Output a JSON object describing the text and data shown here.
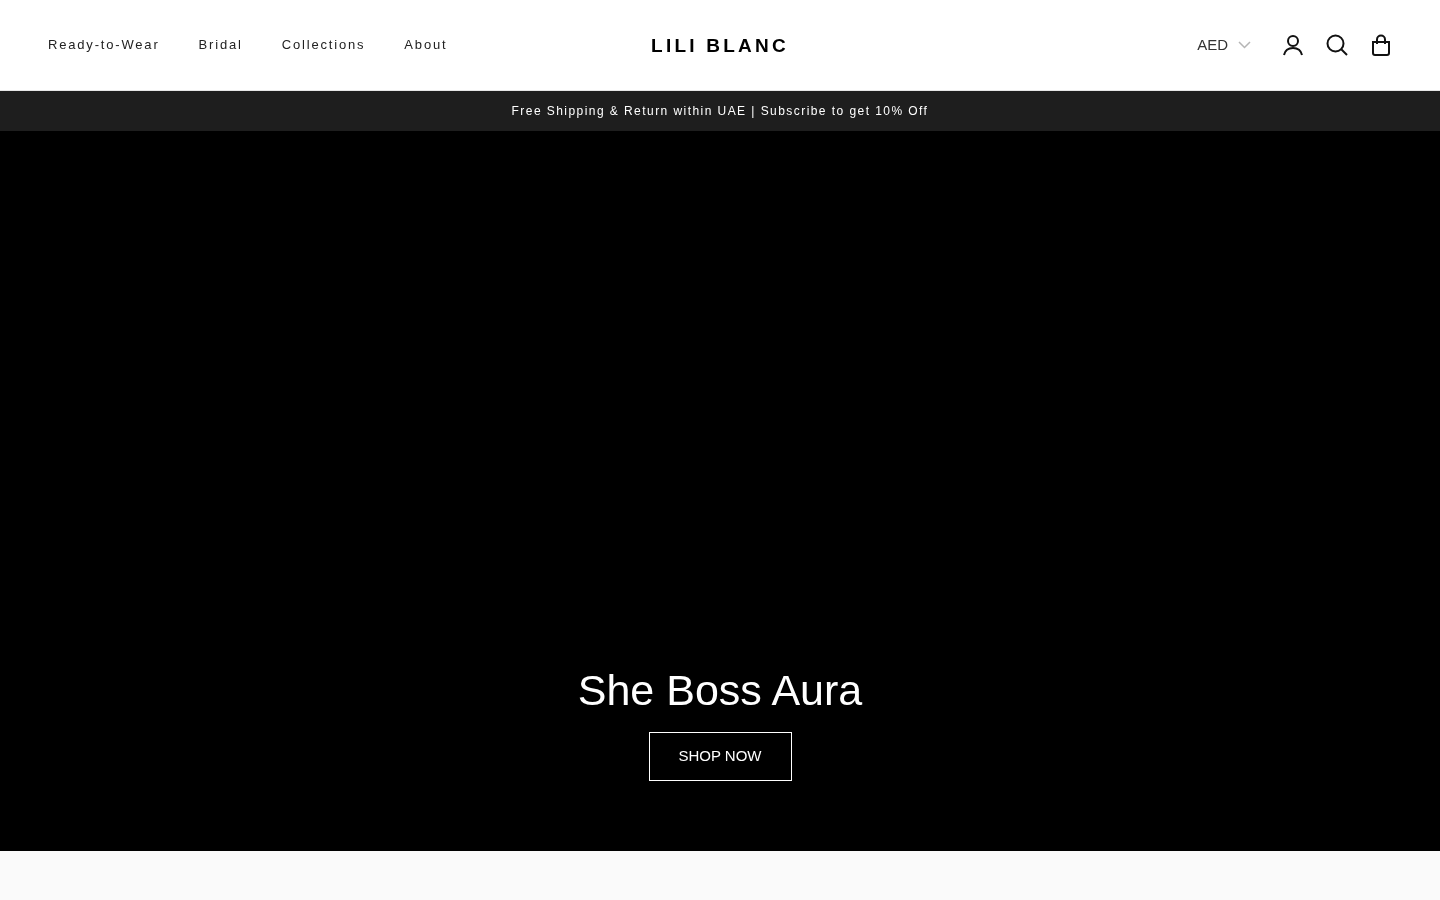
{
  "header": {
    "nav": [
      "Ready-to-Wear",
      "Bridal",
      "Collections",
      "About"
    ],
    "logo": "LILI BLANC",
    "currency": "AED"
  },
  "announcement": "Free Shipping & Return within UAE | Subscribe to get 10% Off",
  "hero": {
    "title": "She Boss Aura",
    "button": "SHOP NOW"
  }
}
